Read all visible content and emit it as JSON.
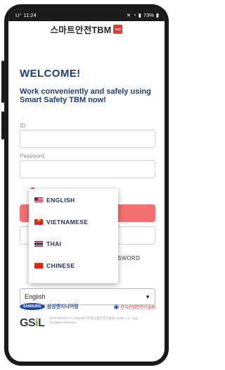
{
  "status_bar": {
    "time": "11:24",
    "carrier": "U⁺",
    "battery": "73%"
  },
  "logo": {
    "text": "스마트안전TBM",
    "badge": "TBM"
  },
  "welcome": {
    "title": "WELCOME!",
    "subtitle": "Work conveniently and safely using Smart Safety TBM now!"
  },
  "form": {
    "id_label": "ID",
    "id_value": "",
    "password_label": "Password",
    "password_value": "",
    "find_password": "SWORD"
  },
  "language": {
    "selected": "English",
    "options": [
      {
        "label": "ENGLISH",
        "flag": "us-flag"
      },
      {
        "label": "VIETNAMESE",
        "flag": "vn-flag"
      },
      {
        "label": "THAI",
        "flag": "th-flag"
      },
      {
        "label": "CHINESE",
        "flag": "cn-flag"
      }
    ]
  },
  "partners": {
    "samsung": "SAMSUNG",
    "samsung_eng": "삼성엔지니어링",
    "kosha": "한국산업안전기술원"
  },
  "footer": {
    "brand_gs": "GS",
    "brand_i": "i",
    "brand_l": "L",
    "copyright": "COPYRIGHT © 2022 BY 한국산업안전기술원, GSIL Co., Ltd. All rights reserved"
  },
  "colors": {
    "brand_navy": "#1f3e77",
    "accent_red": "#e53935",
    "button_pink": "#f27070",
    "green": "#5cab3b"
  }
}
